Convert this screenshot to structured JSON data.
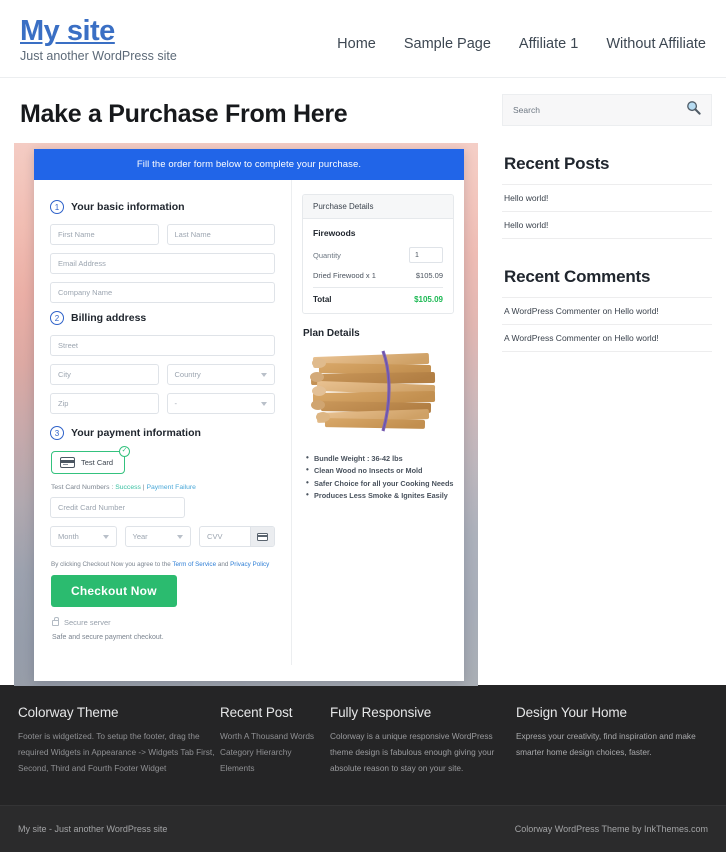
{
  "header": {
    "site_title": "My site",
    "tagline": "Just another WordPress site",
    "nav": [
      {
        "label": "Home"
      },
      {
        "label": "Sample Page"
      },
      {
        "label": "Affiliate 1"
      },
      {
        "label": "Without Affiliate"
      }
    ]
  },
  "main": {
    "page_title": "Make a Purchase From Here",
    "form": {
      "banner": "Fill the order form below to complete your purchase.",
      "step1": {
        "number": "1",
        "label": "Your basic information",
        "first_name_placeholder": "First Name",
        "last_name_placeholder": "Last Name",
        "email_placeholder": "Email Address",
        "company_placeholder": "Company Name"
      },
      "step2": {
        "number": "2",
        "label": "Billing address",
        "street_placeholder": "Street",
        "city_placeholder": "City",
        "country_placeholder": "Country",
        "zip_placeholder": "Zip",
        "state_placeholder": "-"
      },
      "step3": {
        "number": "3",
        "label": "Your payment information",
        "card_option_label": "Test Card",
        "selected_check": "✓",
        "test_card_prefix": "Test Card Numbers : ",
        "test_card_success": "Success",
        "test_card_separator": " | ",
        "test_card_failure": "Payment Failure",
        "cc_number_placeholder": "Credit Card Number",
        "month_placeholder": "Month",
        "year_placeholder": "Year",
        "cvv_placeholder": "CVV"
      },
      "terms_prefix": "By clicking Checkout Now you agree to the ",
      "terms_link_1": "Term of Service",
      "terms_mid": " and ",
      "terms_link_2": "Privacy Policy",
      "checkout_label": "Checkout Now",
      "secure_server": "Secure server",
      "safe_note": "Safe and secure payment checkout."
    },
    "purchase": {
      "panel_title": "Purchase Details",
      "product_name": "Firewoods",
      "quantity_label": "Quantity",
      "quantity_value": "1",
      "line_item_label": "Dried Firewood x 1",
      "line_item_price": "$105.09",
      "total_label": "Total",
      "total_price": "$105.09"
    },
    "plan": {
      "title": "Plan Details",
      "bullets": [
        "Bundle Weight : 36-42 lbs",
        "Clean Wood no Insects or Mold",
        "Safer Choice for all your Cooking Needs",
        "Produces Less Smoke & Ignites Easily"
      ]
    }
  },
  "sidebar": {
    "search_placeholder": "Search",
    "recent_posts": {
      "title": "Recent Posts",
      "items": [
        {
          "label": "Hello world!"
        },
        {
          "label": "Hello world!"
        }
      ]
    },
    "recent_comments": {
      "title": "Recent Comments",
      "items": [
        {
          "label": "A WordPress Commenter on Hello world!"
        },
        {
          "label": "A WordPress Commenter on Hello world!"
        }
      ]
    }
  },
  "footer": {
    "columns": [
      {
        "title": "Colorway Theme",
        "text": "Footer is widgetized. To setup the footer, drag the required Widgets in Appearance -> Widgets Tab First, Second, Third and Fourth Footer Widget"
      },
      {
        "title": "Recent Post",
        "items": [
          {
            "label": "Worth A Thousand Words"
          },
          {
            "label": "Category Hierarchy"
          },
          {
            "label": "Elements"
          }
        ]
      },
      {
        "title": "Fully Responsive",
        "text": "Colorway is a unique responsive WordPress theme design is fabulous enough giving your absolute reason to stay on your site."
      },
      {
        "title": "Design Your Home",
        "text": "Express your creativity, find inspiration and make smarter home design choices, faster."
      }
    ],
    "bottom_left": "My site - Just another WordPress site",
    "bottom_right": "Colorway WordPress Theme by InkThemes.com"
  },
  "colors": {
    "brand_blue": "#3a6fc4",
    "banner_blue": "#2165e8",
    "checkout_green": "#2bbb6f",
    "total_green": "#1db954",
    "footer_dark": "#252526"
  }
}
